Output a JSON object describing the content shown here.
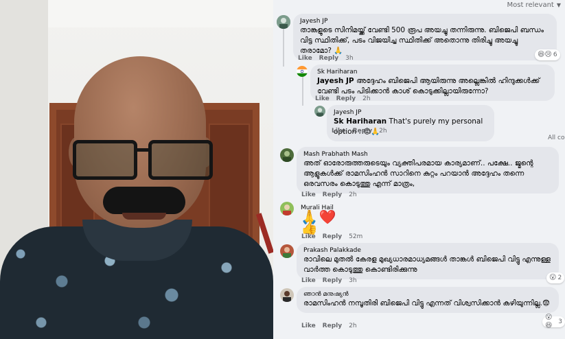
{
  "sort_label": "Most relevant",
  "all_comments_label": "All commen",
  "comments": [
    {
      "author": "Jayesh JP",
      "text": "താങ്കളുടെ സിനിമയ്ക്ക് വേണ്ടി 500 രൂപ അയച്ചു തന്നിരുന്നു. ബിജെപി ബന്ധം വിട്ട സ്ഥിതിക്ക്, പടം വിജയിച്ച സ്ഥിതിക്ക് അതൊന്നു തിരിച്ചു അയച്ചു തരാമോ? 🙏",
      "actions": {
        "like": "Like",
        "reply": "Reply",
        "time": "3h"
      },
      "reactions": {
        "icons": "😆😢",
        "count": "6"
      }
    },
    {
      "author": "Sk Hariharan",
      "mention": "Jayesh JP",
      "text": " അദ്ദേഹം ബിജെപി ആയിരുന്നു അല്ലെങ്കിൽ ഹിന്ദുക്കൾക്ക് വേണ്ടി പടം പിടിക്കാൻ കാശ് കൊടുക്കില്ലായിരുന്നോ?",
      "actions": {
        "like": "Like",
        "reply": "Reply",
        "time": "2h"
      }
    },
    {
      "author": "Jayesh JP",
      "mention": "Sk Hariharan",
      "text": " That's purely my personal option . 😊🙏",
      "actions": {
        "like": "Like",
        "reply": "Reply",
        "time": "2h"
      }
    },
    {
      "author": "Mash Prabhath Mash",
      "text": "അത് ഓരോരുത്തരുടെയും വ്യക്തിപരമായ കാര്യമാണ്.. പക്ഷേ.. ജ്മന്റെ ആളുകൾക്ക് രാമസിംഹൻ സാറിനെ കുറ്റം പറയാൻ അദ്ദേഹം തന്നെ ഒരവസരം കൊടുത്തു എന്ന് മാത്രം,",
      "actions": {
        "like": "Like",
        "reply": "Reply",
        "time": "2h"
      }
    },
    {
      "author": "Murali Hail",
      "text": "🙏❤️👍",
      "actions": {
        "like": "Like",
        "reply": "Reply",
        "time": "52m"
      }
    },
    {
      "author": "Prakash Palakkade",
      "text": "രാവിലെ മുതൽ കേരള മുഖ്യധാരമാധ്യമങ്ങൾ താങ്കൾ ബിജെപി വിട്ടു എന്നുള്ള വാർത്ത കൊടുത്തു കൊണ്ടിരിക്കുന്നു",
      "actions": {
        "like": "Like",
        "reply": "Reply",
        "time": "3h"
      },
      "reactions": {
        "icons": "😮",
        "count": "2"
      }
    },
    {
      "author": "ഞാൻ മനുഷ്യൻ",
      "text": "രാമസിംഹൻ നമ്പൂതിരി ബിജെപി വിട്ടു എന്നത് വിശ്വസിക്കാൻ കഴിയുന്നില്ല.😨",
      "actions": {
        "like": "Like",
        "reply": "Reply",
        "time": "2h"
      },
      "reactions": {
        "icons": "😮😆",
        "count": "3"
      }
    }
  ],
  "colors": {
    "panel_bg": "#f0f2f5",
    "bubble_bg": "#e4e6eb",
    "meta_text": "#65676b",
    "door_wood": "#7a3c24",
    "shirt_dark": "#1f2a33"
  },
  "icons": [
    "chevron-down-icon"
  ]
}
